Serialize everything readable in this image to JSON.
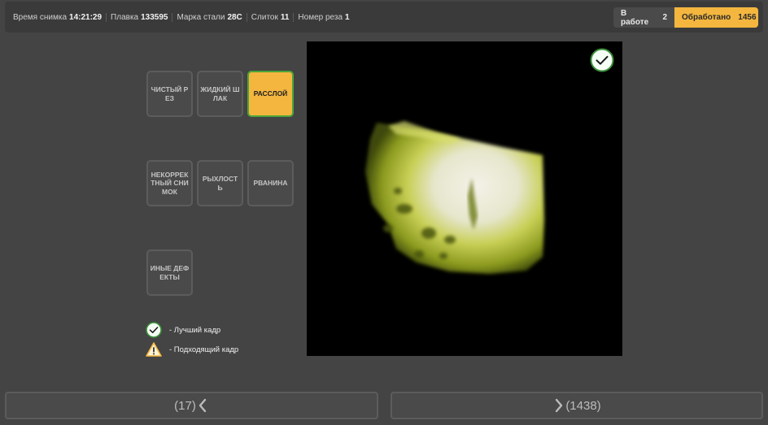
{
  "header": {
    "capture_time_label": "Время снимка",
    "capture_time": "14:21:29",
    "melt_label": "Плавка",
    "melt": "133595",
    "steel_grade_label": "Марка стали",
    "steel_grade": "28С",
    "ingot_label": "Слиток",
    "ingot": "11",
    "cut_label": "Номер реза",
    "cut": "1"
  },
  "stats": {
    "in_work_label": "В работе",
    "in_work": "2",
    "processed_label": "Обработано",
    "processed": "1456"
  },
  "defects": [
    {
      "label": "ЧИСТЫЙ РЕЗ",
      "active": false
    },
    {
      "label": "ЖИДКИЙ ШЛАК",
      "active": false
    },
    {
      "label": "РАССЛОЙ",
      "active": true
    },
    {
      "label": "НЕКОРРЕКТНЫЙ СНИМОК",
      "active": false
    },
    {
      "label": "РЫХЛОСТЬ",
      "active": false
    },
    {
      "label": "РВАНИНА",
      "active": false
    },
    {
      "label": "ИНЫЕ ДЕФЕКТЫ",
      "active": false
    }
  ],
  "legend": {
    "best_frame": "- Лучший кадр",
    "suitable_frame": "- Подходящий кадр"
  },
  "image": {
    "icons": {
      "badge": "check-circle-icon"
    },
    "colors": {
      "accent": "#f4b63f",
      "check_green": "#3a8f3a",
      "scan_yellow": "#c8d24a"
    }
  },
  "navigation": {
    "prev_count": "(17)",
    "next_count": "(1438)",
    "icons": {
      "prev": "chevron-left-icon",
      "next": "chevron-right-icon"
    }
  }
}
